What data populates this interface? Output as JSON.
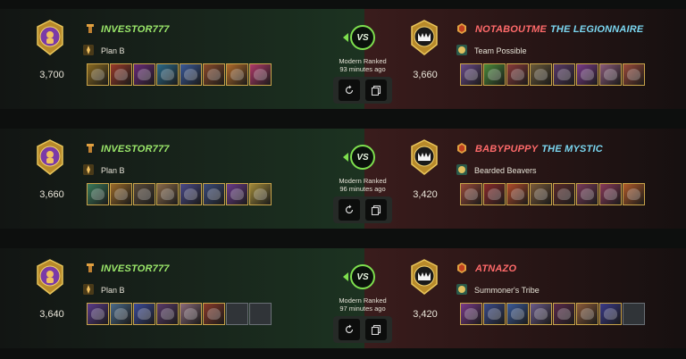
{
  "battles": [
    {
      "mode_line1": "Modern Ranked",
      "mode_line2": "93 minutes ago",
      "vs_label": "VS",
      "left": {
        "name": "INVESTOR777",
        "title": "",
        "rating": "3,700",
        "guild": "Plan B",
        "cards": [
          "#8a6a20",
          "#9a3a2a",
          "#6a2a7a",
          "#2a6a8a",
          "#3a5a9a",
          "#8a4a2a",
          "#b06a2a",
          "#b03a6a"
        ]
      },
      "right": {
        "name": "NOTABOUTME",
        "title": "THE LEGIONNAIRE",
        "rating": "3,660",
        "guild": "Team Possible",
        "cards": [
          "#6a4a8a",
          "#4a8a3a",
          "#8a3a3a",
          "#6a5a3a",
          "#5a3a6a",
          "#7a3a8a",
          "#8a5a7a",
          "#9a4a3a"
        ]
      }
    },
    {
      "mode_line1": "Modern Ranked",
      "mode_line2": "96 minutes ago",
      "vs_label": "VS",
      "left": {
        "name": "INVESTOR777",
        "title": "",
        "rating": "3,660",
        "guild": "Plan B",
        "cards": [
          "#3a7a5a",
          "#9a6a2a",
          "#5a4a3a",
          "#8a6a4a",
          "#4a4a8a",
          "#3a4a7a",
          "#6a3a8a",
          "#a08a3a"
        ]
      },
      "right": {
        "name": "BABYPUPPY",
        "title": "THE MYSTIC",
        "rating": "3,420",
        "guild": "Bearded Beavers",
        "cards": [
          "#9a4a3a",
          "#8a2a2a",
          "#b04a2a",
          "#7a5a3a",
          "#5a2a2a",
          "#7a3a5a",
          "#8a3a5a",
          "#b05a2a"
        ]
      }
    },
    {
      "mode_line1": "Modern Ranked",
      "mode_line2": "97 minutes ago",
      "vs_label": "VS",
      "left": {
        "name": "INVESTOR777",
        "title": "",
        "rating": "3,640",
        "guild": "Plan B",
        "cards": [
          "#5a3a8a",
          "#4a6a8a",
          "#3a4a9a",
          "#5a3a6a",
          "#8a6a7a",
          "#8a3a2a",
          "",
          ""
        ]
      },
      "right": {
        "name": "ATNAZO",
        "title": "",
        "rating": "3,420",
        "guild": "Summoner's Tribe",
        "cards": [
          "#7a3a8a",
          "#3a4a8a",
          "#3a5a9a",
          "#6a5a8a",
          "#5a2a4a",
          "#8a5a3a",
          "#3a3a8a",
          ""
        ]
      }
    }
  ],
  "icons": {
    "badge": "league-badge-icon",
    "guild": "guild-banner-icon",
    "player": "player-rank-icon",
    "replay": "replay-icon",
    "copy": "copy-team-icon"
  }
}
